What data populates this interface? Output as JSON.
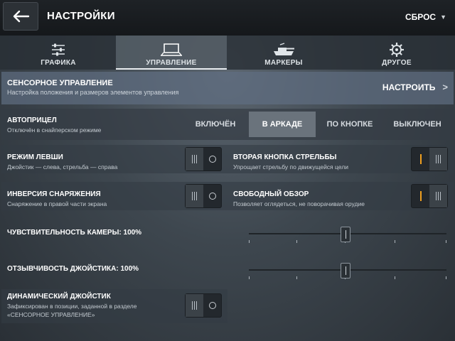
{
  "header": {
    "title": "НАСТРОЙКИ",
    "reset_label": "СБРОС"
  },
  "tabs": [
    {
      "label": "ГРАФИКА",
      "icon": "sliders-icon",
      "active": false
    },
    {
      "label": "УПРАВЛЕНИЕ",
      "icon": "tablet-icon",
      "active": true
    },
    {
      "label": "МАРКЕРЫ",
      "icon": "tank-icon",
      "active": false
    },
    {
      "label": "ДРУГОЕ",
      "icon": "gear-icon",
      "active": false
    }
  ],
  "touch_control": {
    "title": "СЕНСОРНОЕ УПРАВЛЕНИЕ",
    "subtitle": "Настройка положения и размеров элементов управления",
    "button_label": "НАСТРОИТЬ"
  },
  "autoaim": {
    "title": "АВТОПРИЦЕЛ",
    "subtitle": "Отключён в снайперском режиме",
    "options": [
      "ВКЛЮЧЁН",
      "В АРКАДЕ",
      "ПО КНОПКЕ",
      "ВЫКЛЮЧЕН"
    ],
    "selected": "В АРКАДЕ"
  },
  "settings": {
    "left_hand": {
      "title": "РЕЖИМ ЛЕВШИ",
      "subtitle": "Джойстик — слева, стрельба — справа",
      "enabled": false
    },
    "second_fire": {
      "title": "ВТОРАЯ КНОПКА СТРЕЛЬБЫ",
      "subtitle": "Упрощает стрельбу по движущейся цели",
      "enabled": true
    },
    "equipment_inversion": {
      "title": "ИНВЕРСИЯ СНАРЯЖЕНИЯ",
      "subtitle": "Снаряжение в правой части экрана",
      "enabled": false
    },
    "free_look": {
      "title": "СВОБОДНЫЙ ОБЗОР",
      "subtitle": "Позволяет оглядеться, не поворачивая орудие",
      "enabled": true
    },
    "dynamic_joystick": {
      "title": "ДИНАМИЧЕСКИЙ ДЖОЙСТИК",
      "subtitle_line1": "Зафиксирован в позиции, заданной в разделе",
      "subtitle_line2": "«СЕНСОРНОЕ УПРАВЛЕНИЕ»",
      "enabled": false
    }
  },
  "sliders": {
    "camera": {
      "label": "ЧУВСТВИТЕЛЬНОСТЬ КАМЕРЫ: 100%",
      "value_percent": 100,
      "position_fraction": 0.49
    },
    "joystick": {
      "label": "ОТЗЫВЧИВОСТЬ ДЖОЙСТИКА: 100%",
      "value_percent": 100,
      "position_fraction": 0.49
    }
  },
  "colors": {
    "accent": "#f0a020",
    "active_tab": "#6e7882"
  }
}
